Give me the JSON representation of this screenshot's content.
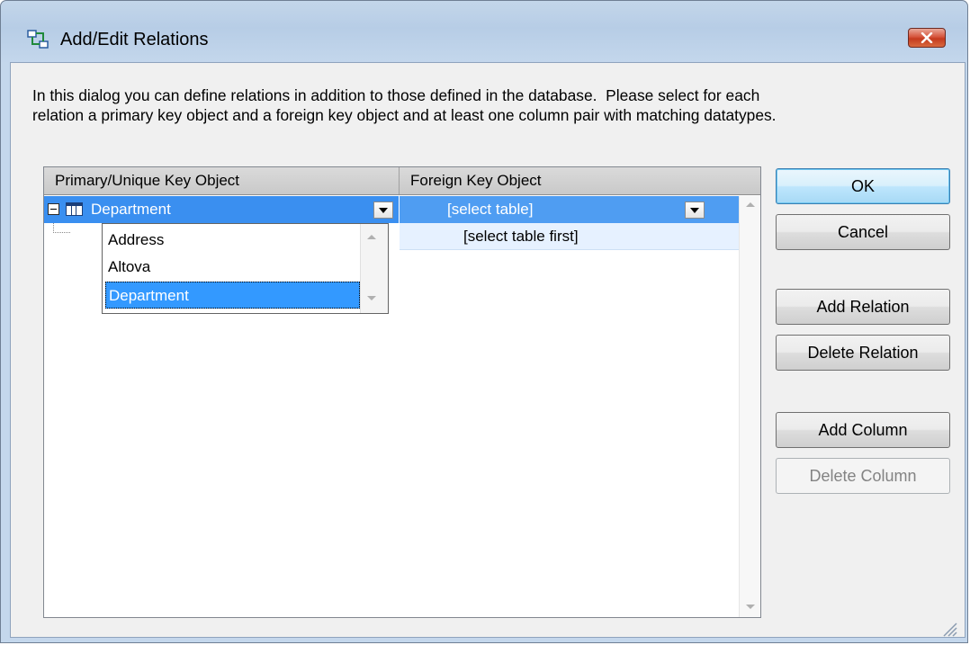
{
  "window": {
    "title": "Add/Edit Relations",
    "icon": "relations-icon",
    "close_icon": "close-icon",
    "accent": "#3399ff",
    "close_color": "#c53a1e"
  },
  "description": {
    "line1": "In this dialog you can define relations in addition to those defined in the database.  Please select for each",
    "line2": "relation a primary key object and a foreign key object and at least one column pair with matching datatypes."
  },
  "grid": {
    "columns": [
      "Primary/Unique Key Object",
      "Foreign Key Object"
    ],
    "rows": [
      {
        "primary": "Department",
        "foreign": "[select table]"
      },
      {
        "primary": "",
        "foreign": "[select table first]"
      }
    ],
    "dropdown": {
      "options": [
        "Address",
        "Altova",
        "Department"
      ],
      "selected": "Department"
    }
  },
  "buttons": {
    "ok": "OK",
    "cancel": "Cancel",
    "add_relation": "Add Relation",
    "delete_relation": "Delete Relation",
    "add_column": "Add Column",
    "delete_column": "Delete Column"
  }
}
